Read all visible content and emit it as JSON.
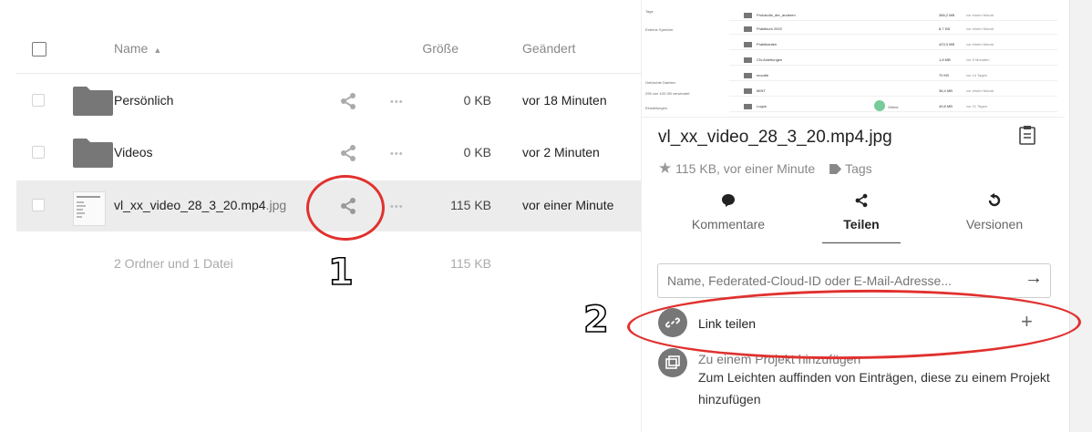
{
  "table": {
    "col_name": "Name",
    "col_size": "Größe",
    "col_modified": "Geändert",
    "rows": [
      {
        "name": "Persönlich",
        "ext": "",
        "size": "0 KB",
        "modified": "vor 18 Minuten"
      },
      {
        "name": "Videos",
        "ext": "",
        "size": "0 KB",
        "modified": "vor 2 Minuten"
      },
      {
        "name": "vl_xx_video_28_3_20.mp4",
        "ext": ".jpg",
        "size": "115 KB",
        "modified": "vor einer Minute"
      }
    ],
    "summary": "2 Ordner und 1 Datei",
    "summary_size": "115 KB"
  },
  "annotations": {
    "one": "1",
    "two": "2"
  },
  "sidebar": {
    "preview": {
      "nav": [
        "Tags",
        "Externe Speicher",
        "Gelöschte Dateien",
        "295 von 100 GB verwendet",
        "Einstellungen"
      ],
      "rows": [
        {
          "name": "Protokolle_der_anderen",
          "size": "366,2 MB",
          "date": "vor einem Monat"
        },
        {
          "name": "Praktikum 2020",
          "size": "8,7 KB",
          "date": "vor einem Monat"
        },
        {
          "name": "Praktikanten",
          "size": "423,3 MB",
          "date": "vor einem Monat"
        },
        {
          "name": "CN-Anleitungen",
          "size": "1,8 MB",
          "date": "vor 5 Monaten"
        },
        {
          "name": "moodle",
          "size": "70 KB",
          "date": "vor 14 Tagen"
        },
        {
          "name": "MINT",
          "size": "36,4 MB",
          "date": "vor einem Monat"
        },
        {
          "name": "Logos",
          "size": "49,8 MB",
          "date": "vor 21 Tagen"
        }
      ],
      "badge": "Online"
    },
    "title": "vl_xx_video_28_3_20.mp4.jpg",
    "meta_size": "115 KB, vor einer Minute",
    "meta_tags": "Tags",
    "tabs": [
      "Kommentare",
      "Teilen",
      "Versionen"
    ],
    "share_placeholder": "Name, Federated-Cloud-ID oder E-Mail-Adresse...",
    "link_label": "Link teilen",
    "project_title": "Zu einem Projekt hinzufügen",
    "project_desc": "Zum Leichten auffinden von Einträgen, diese zu einem Projekt hinzufügen"
  },
  "colors": {
    "annotation": "#e0312e",
    "folder": "#777777"
  }
}
